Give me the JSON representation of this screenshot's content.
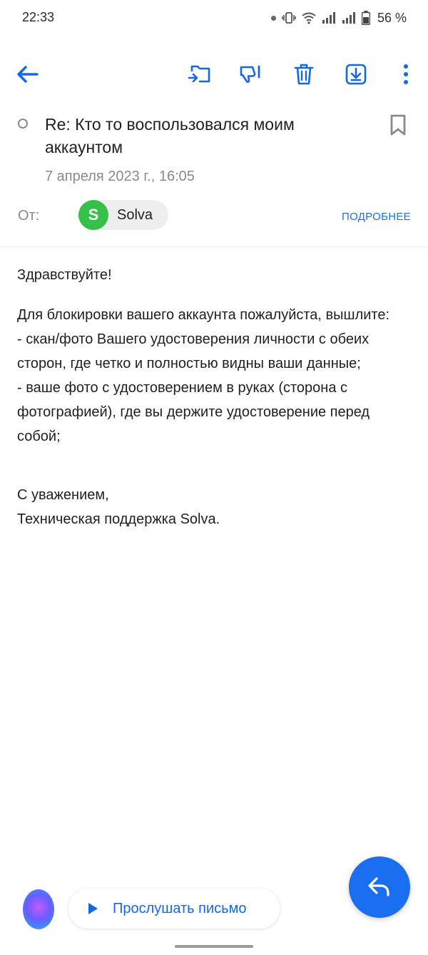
{
  "status_bar": {
    "time": "22:33",
    "battery": "56 %"
  },
  "toolbar": {
    "icons": [
      "back-arrow-icon",
      "move-to-folder-icon",
      "spam-icon",
      "delete-icon",
      "download-icon",
      "more-icon"
    ],
    "accent_color": "#1567e8"
  },
  "message": {
    "subject": "Re: Кто то воспользовался моим аккаунтом",
    "date": "7 апреля 2023 г., 16:05",
    "from_label": "От:",
    "sender": {
      "initial": "S",
      "name": "Solva",
      "avatar_color": "#35c049"
    },
    "details_link": "ПОДРОБНЕЕ",
    "body": {
      "greeting": "Здравствуйте!",
      "line1": "Для блокировки вашего аккаунта пожалуйста, вышлите:",
      "line2": "- скан/фото Вашего удостоверения личности с обеих сторон, где четко и полностью видны ваши данные;",
      "line3": "- ваше фото с удостоверением в руках (сторона с фотографией), где вы держите удостоверение перед собой;",
      "signoff": "С уважением,",
      "signature": "Техническая поддержка Solva."
    }
  },
  "bottom": {
    "listen_label": "Прослушать письмо"
  }
}
